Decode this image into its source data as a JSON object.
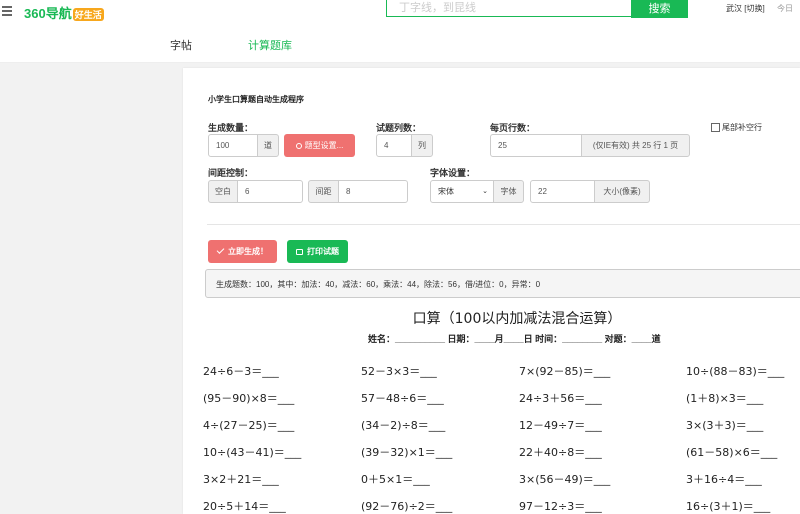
{
  "header": {
    "logo_text": "360导航",
    "logo_badge": "好生活",
    "search_placeholder": "丁字线，到昆线",
    "search_button": "搜索",
    "city": "武汉 [切换]",
    "weather": "今日"
  },
  "nav": {
    "tabs": [
      {
        "label": "字帖"
      },
      {
        "label": "计算题库"
      }
    ]
  },
  "form": {
    "title": "小学生口算题自动生成程序",
    "gen_count": {
      "label": "生成数量：",
      "value": "100",
      "unit": "道"
    },
    "type_button": "题型设置...",
    "columns": {
      "label": "试题列数：",
      "value": "4",
      "unit": "列"
    },
    "rows": {
      "label": "每页行数：",
      "value": "25",
      "note": "(仅IE有效) 共 25 行 1 页"
    },
    "trailing_blank": "尾部补空行",
    "spacing": {
      "label": "间距控制：",
      "blank_label": "空白",
      "blank_value": "6",
      "gap_label": "间距",
      "gap_value": "8"
    },
    "font": {
      "label": "字体设置：",
      "family": "宋体",
      "family_label": "字体",
      "size_value": "22",
      "size_label": "大小(像素)"
    },
    "generate_button": "立即生成！",
    "print_button": "打印试题"
  },
  "result": "生成题数：100，其中：加法：40，减法：60，乘法：44，除法：56，借/进位：0，异常：0",
  "sheet": {
    "title": "口算（100以内加减法混合运算）",
    "info": "姓名：__________ 日期：____月____日 时间：________ 对题：____道",
    "problems": [
      [
        "24÷6－3＝___",
        "52－3×3＝___",
        "7×(92－85)＝___",
        "10÷(88－83)＝___"
      ],
      [
        "(95－90)×8＝___",
        "57－48÷6＝___",
        "24÷3＋56＝___",
        "(1＋8)×3＝___"
      ],
      [
        "4÷(27－25)＝___",
        "(34－2)÷8＝___",
        "12－49÷7＝___",
        "3×(3＋3)＝___"
      ],
      [
        "10÷(43－41)＝___",
        "(39－32)×1＝___",
        "22＋40÷8＝___",
        "(61－58)×6＝___"
      ],
      [
        "3×2＋21＝___",
        "0＋5×1＝___",
        "3×(56－49)＝___",
        "3＋16÷4＝___"
      ],
      [
        "20÷5＋14＝___",
        "(92－76)÷2＝___",
        "97－12÷3＝___",
        "16÷(3＋1)＝___"
      ]
    ]
  },
  "colors": {
    "brand": "#19b955",
    "danger": "#ef7170"
  }
}
